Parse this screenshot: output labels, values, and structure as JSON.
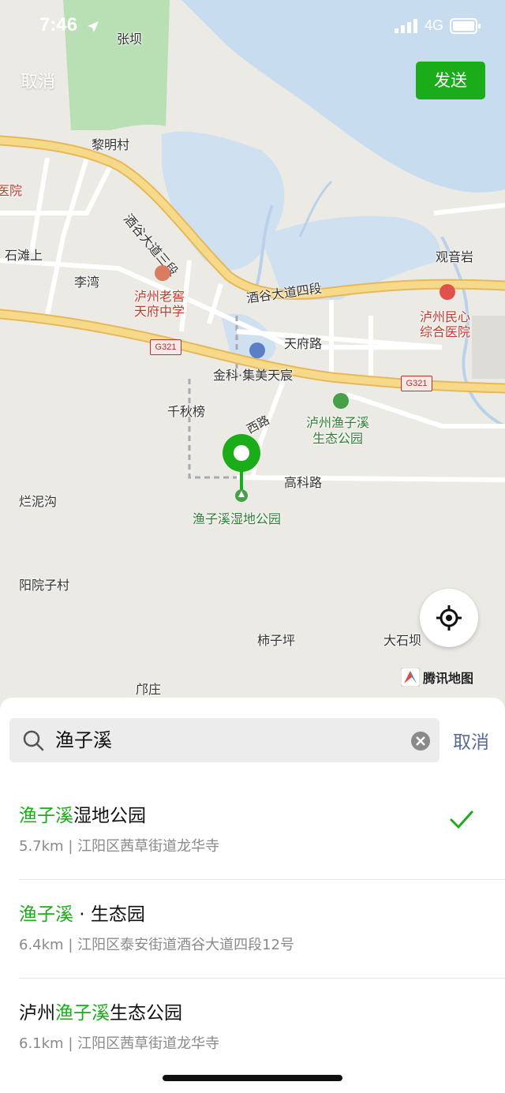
{
  "status_bar": {
    "time": "7:46",
    "network": "4G"
  },
  "nav": {
    "cancel_label": "取消",
    "send_label": "发送"
  },
  "map": {
    "labels": {
      "zhangba": "张坝",
      "limingcun": "黎明村",
      "road_jiugu_3": "酒谷大道三段",
      "yuan": "医院",
      "shitanshang": "石滩上",
      "liwan": "李湾",
      "luzhou_laojiao": "泸州老窖",
      "tianfu_middle": "天府中学",
      "road_jiugu_4": "酒谷大道四段",
      "guanyinyan": "观音岩",
      "luzhou_minxin": "泸州民心",
      "zonghe_yiyuan": "综合医院",
      "tianfu_road": "天府路",
      "jinke": "金科·集美天宸",
      "qianqiubang": "千秋榜",
      "west_road": "西路",
      "ecopark_1": "泸州渔子溪",
      "ecopark_2": "生态公园",
      "gaoke_road": "高科路",
      "lannigou": "烂泥沟",
      "wetland": "渔子溪湿地公园",
      "yangyuanzicun": "阳院子村",
      "shiziping": "柿子坪",
      "dashiba": "大石坝",
      "qiongzhuang": "邝庄"
    },
    "shields": {
      "g321_left": "G321",
      "g321_right": "G321"
    },
    "provider": "腾讯地图",
    "colors": {
      "road": "#f4d27a",
      "water": "#c8dcf0",
      "green": "#a5d6a7",
      "pin": "#1aad19"
    }
  },
  "search": {
    "query": "渔子溪",
    "cancel_label": "取消"
  },
  "results": [
    {
      "prefix": "",
      "highlight": "渔子溪",
      "suffix": "湿地公园",
      "distance": "5.7km",
      "address": "江阳区茜草街道龙华寺",
      "selected": true
    },
    {
      "prefix": "",
      "highlight": "渔子溪",
      "suffix": " · 生态园",
      "distance": "6.4km",
      "address": "江阳区泰安街道酒谷大道四段12号",
      "selected": false
    },
    {
      "prefix": "泸州",
      "highlight": "渔子溪",
      "suffix": "生态公园",
      "distance": "6.1km",
      "address": "江阳区茜草街道龙华寺",
      "selected": false
    }
  ],
  "separator": " | "
}
